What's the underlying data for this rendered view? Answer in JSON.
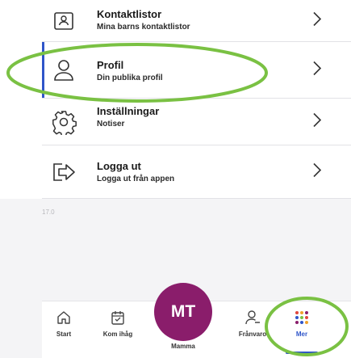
{
  "menu": {
    "items": [
      {
        "icon": "contact-card-icon",
        "title": "Kontaktlistor",
        "subtitle": "Mina barns kontaktlistor"
      },
      {
        "icon": "person-icon",
        "title": "Profil",
        "subtitle": "Din publika profil"
      },
      {
        "icon": "gear-icon",
        "title": "Inställningar",
        "subtitle": "Notiser"
      },
      {
        "icon": "logout-icon",
        "title": "Logga ut",
        "subtitle": "Logga ut från appen"
      }
    ]
  },
  "version": "17.0",
  "tabbar": {
    "tabs": [
      {
        "icon": "home-icon",
        "label": "Start"
      },
      {
        "icon": "calendar-icon",
        "label": "Kom ihåg"
      },
      {
        "icon": "absence-icon",
        "label": "Frånvaro"
      },
      {
        "icon": "grid-dots-icon",
        "label": "Mer"
      }
    ],
    "active": "Mer"
  },
  "profile": {
    "initials": "MT",
    "label": "Mamma"
  },
  "colors": {
    "accent": "#2f55c9",
    "avatar": "#8a1d6b",
    "highlight": "#7ac143",
    "background": "#f4f4f6"
  }
}
